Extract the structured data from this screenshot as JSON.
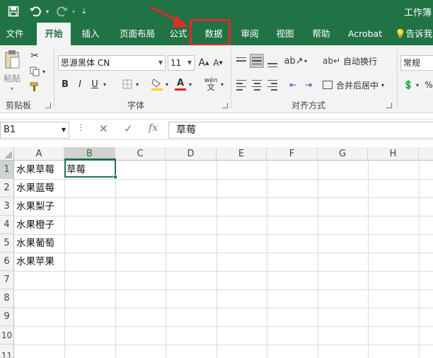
{
  "title": "工作簿",
  "quick_access": {
    "save_icon": "save-icon",
    "undo_icon": "undo-icon",
    "redo_icon": "redo-icon",
    "customize_icon": "customize-icon"
  },
  "tabs": [
    {
      "label": "文件"
    },
    {
      "label": "开始",
      "active": true
    },
    {
      "label": "插入"
    },
    {
      "label": "页面布局"
    },
    {
      "label": "公式"
    },
    {
      "label": "数据",
      "highlighted": true
    },
    {
      "label": "审阅"
    },
    {
      "label": "视图"
    },
    {
      "label": "帮助"
    },
    {
      "label": "Acrobat"
    },
    {
      "label": "告诉我"
    }
  ],
  "ribbon": {
    "clipboard": {
      "paste": "粘贴",
      "group": "剪贴板"
    },
    "font": {
      "name": "思源黑体 CN",
      "size": "11",
      "bold": "B",
      "italic": "I",
      "underline": "U",
      "grow": "A",
      "shrink": "A",
      "phonetic": "wén",
      "group": "字体"
    },
    "alignment": {
      "wrap": "自动换行",
      "merge": "合并后居中",
      "group": "对齐方式"
    },
    "number": {
      "format": "常规",
      "percent": "%"
    }
  },
  "formula_bar": {
    "name_box": "B1",
    "fx": "fx",
    "content": "草莓"
  },
  "columns": [
    "A",
    "B",
    "C",
    "D",
    "E",
    "F",
    "G",
    "H"
  ],
  "rows": [
    "1",
    "2",
    "3",
    "4",
    "5",
    "6",
    "7",
    "8",
    "9",
    "10",
    "11"
  ],
  "cells": {
    "A1": "水果草莓",
    "A2": "水果蓝莓",
    "A3": "水果梨子",
    "A4": "水果橙子",
    "A5": "水果葡萄",
    "A6": "水果苹果",
    "B1": "草莓"
  },
  "selected_cell": "B1",
  "colors": {
    "accent": "#217346",
    "annotation": "#e02b2b"
  }
}
